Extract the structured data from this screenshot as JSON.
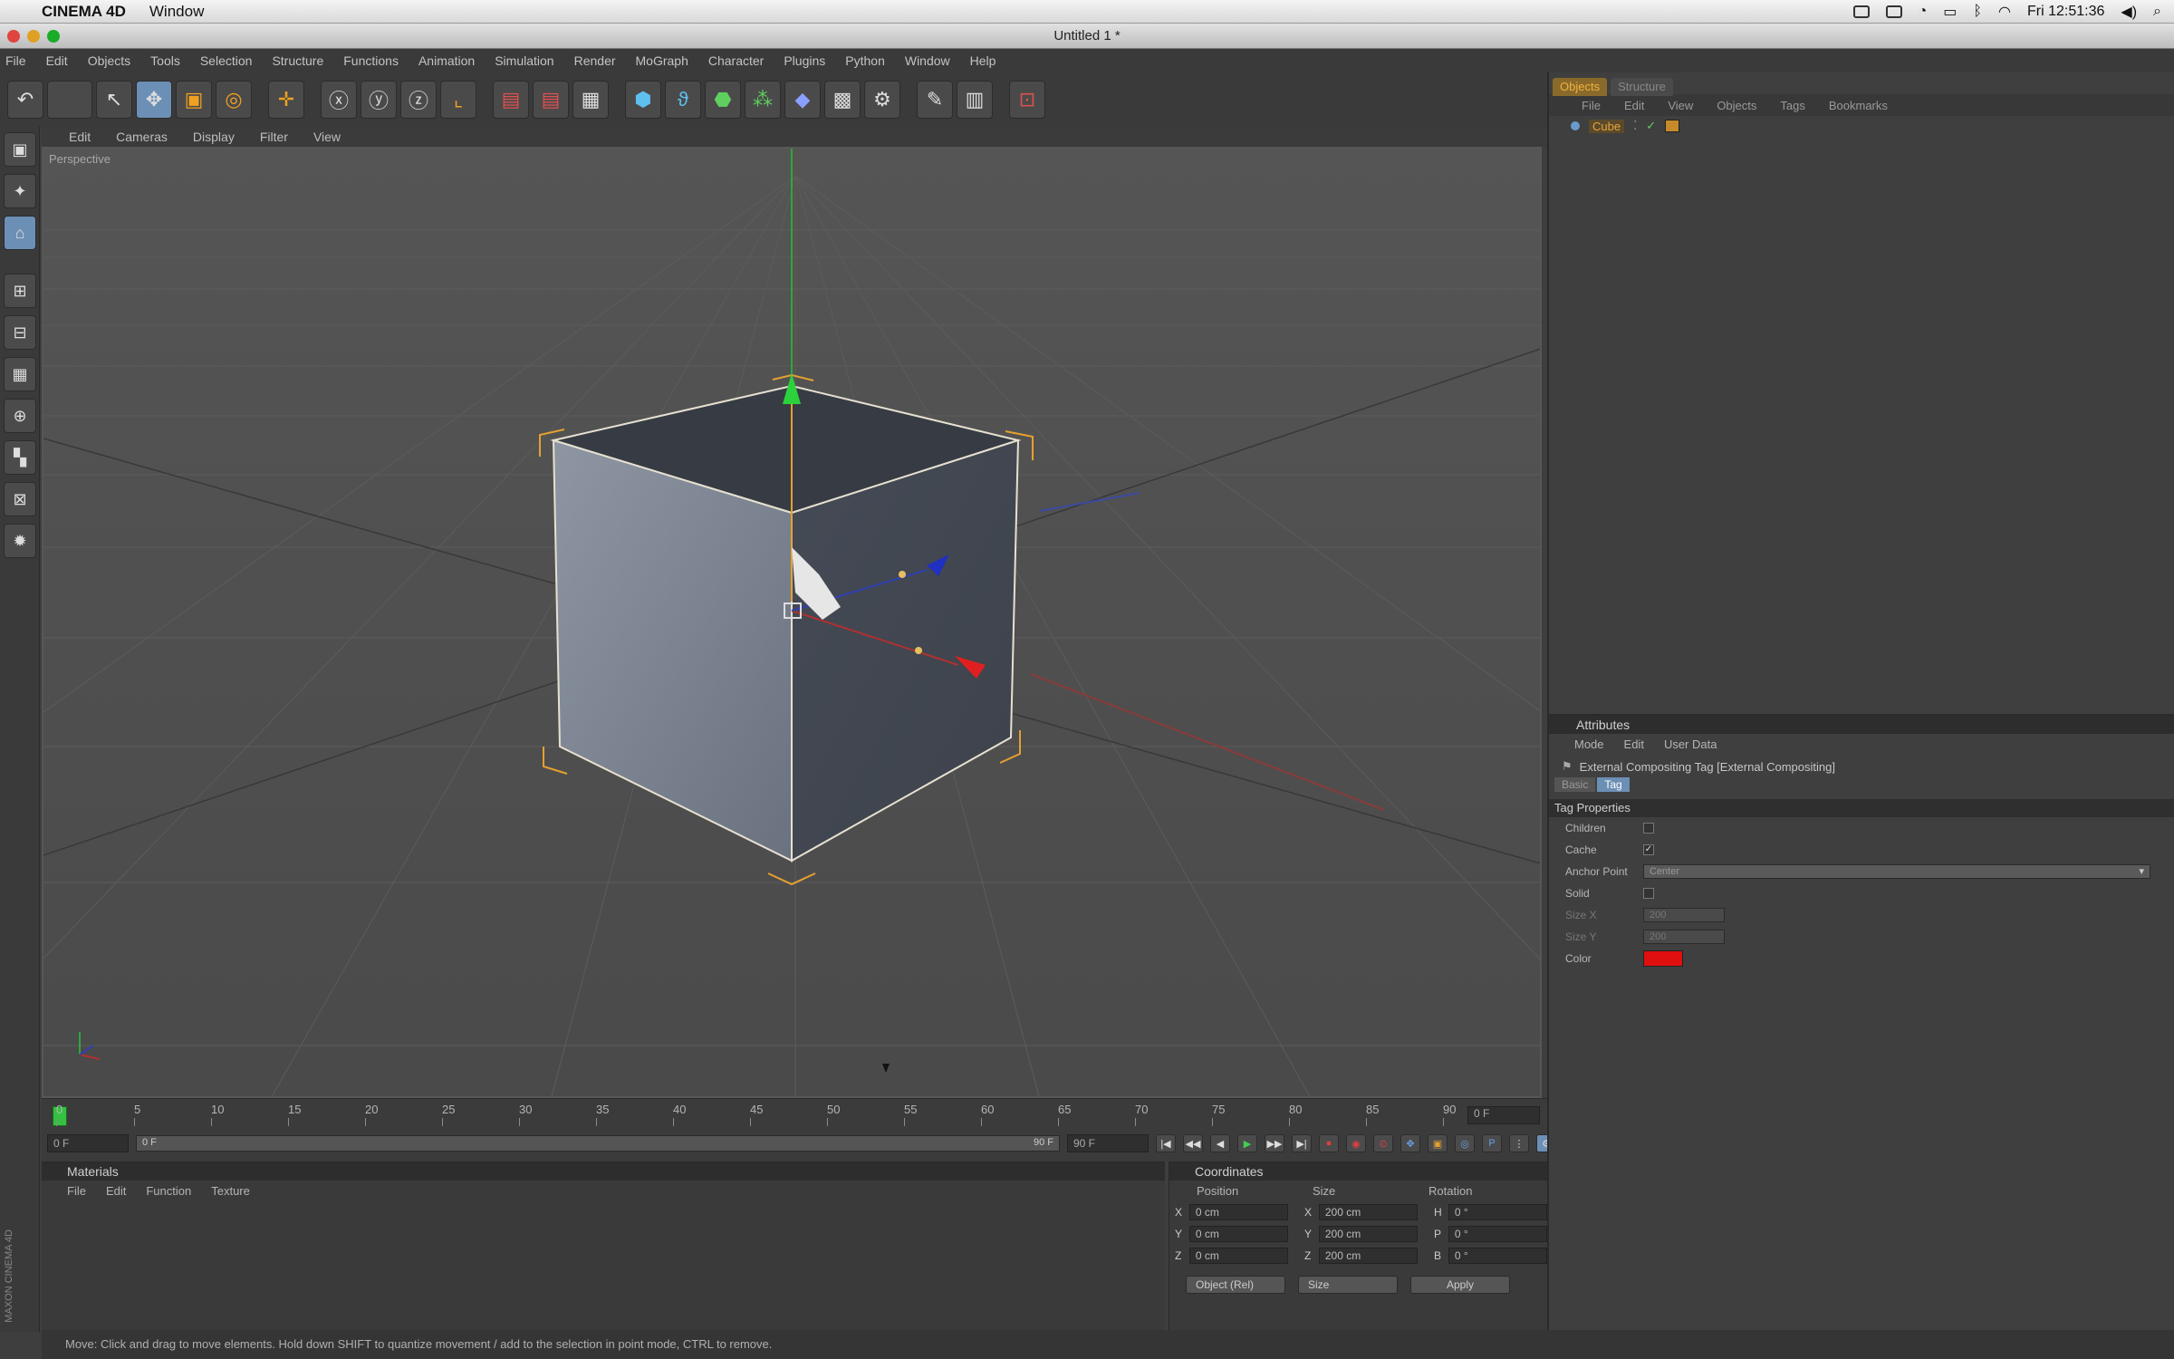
{
  "macbar": {
    "app_name": "CINEMA 4D",
    "menus": [
      "Window"
    ],
    "clock": "Fri 12:51:36"
  },
  "window": {
    "title": "Untitled 1 *"
  },
  "app_menu": [
    "File",
    "Edit",
    "Objects",
    "Tools",
    "Selection",
    "Structure",
    "Functions",
    "Animation",
    "Simulation",
    "Render",
    "MoGraph",
    "Character",
    "Plugins",
    "Python",
    "Window",
    "Help"
  ],
  "viewport": {
    "menu": [
      "Edit",
      "Cameras",
      "Display",
      "Filter",
      "View"
    ],
    "label": "Perspective"
  },
  "timeline": {
    "ticks": [
      "0",
      "5",
      "10",
      "15",
      "20",
      "25",
      "30",
      "35",
      "40",
      "45",
      "50",
      "55",
      "60",
      "65",
      "70",
      "75",
      "80",
      "85",
      "90"
    ],
    "end_field": "0 F",
    "current_frame": "0 F",
    "range_start": "0 F",
    "range_end": "90 F",
    "max_frame": "90 F"
  },
  "materials": {
    "title": "Materials",
    "menu": [
      "File",
      "Edit",
      "Function",
      "Texture"
    ]
  },
  "coordinates": {
    "title": "Coordinates",
    "columns": [
      "Position",
      "Size",
      "Rotation"
    ],
    "rows": [
      {
        "axis": "X",
        "position": "0 cm",
        "size_axis": "X",
        "size": "200 cm",
        "rot_axis": "H",
        "rotation": "0 °"
      },
      {
        "axis": "Y",
        "position": "0 cm",
        "size_axis": "Y",
        "size": "200 cm",
        "rot_axis": "P",
        "rotation": "0 °"
      },
      {
        "axis": "Z",
        "position": "0 cm",
        "size_axis": "Z",
        "size": "200 cm",
        "rot_axis": "B",
        "rotation": "0 °"
      }
    ],
    "mode_select": "Object (Rel)",
    "size_select": "Size",
    "apply_label": "Apply"
  },
  "object_manager": {
    "tabs": [
      "Objects",
      "Structure"
    ],
    "menu": [
      "File",
      "Edit",
      "View",
      "Objects",
      "Tags",
      "Bookmarks"
    ],
    "object_name": "Cube"
  },
  "attributes": {
    "title": "Attributes",
    "menu": [
      "Mode",
      "Edit",
      "User Data"
    ],
    "tag_title": "External Compositing Tag [External Compositing]",
    "subtabs": [
      "Basic",
      "Tag"
    ],
    "section": "Tag Properties",
    "children_label": "Children",
    "cache_label": "Cache",
    "anchor_label": "Anchor Point",
    "anchor_value": "Center",
    "solid_label": "Solid",
    "sizex_label": "Size X",
    "sizex_value": "200",
    "sizey_label": "Size Y",
    "sizey_value": "200",
    "color_label": "Color",
    "color_value": "#e01010"
  },
  "statusbar": {
    "text": "Move: Click and drag to move elements. Hold down SHIFT to quantize movement / add to the selection in point mode, CTRL to remove."
  },
  "left_vertical_label": "MAXON CINEMA 4D"
}
